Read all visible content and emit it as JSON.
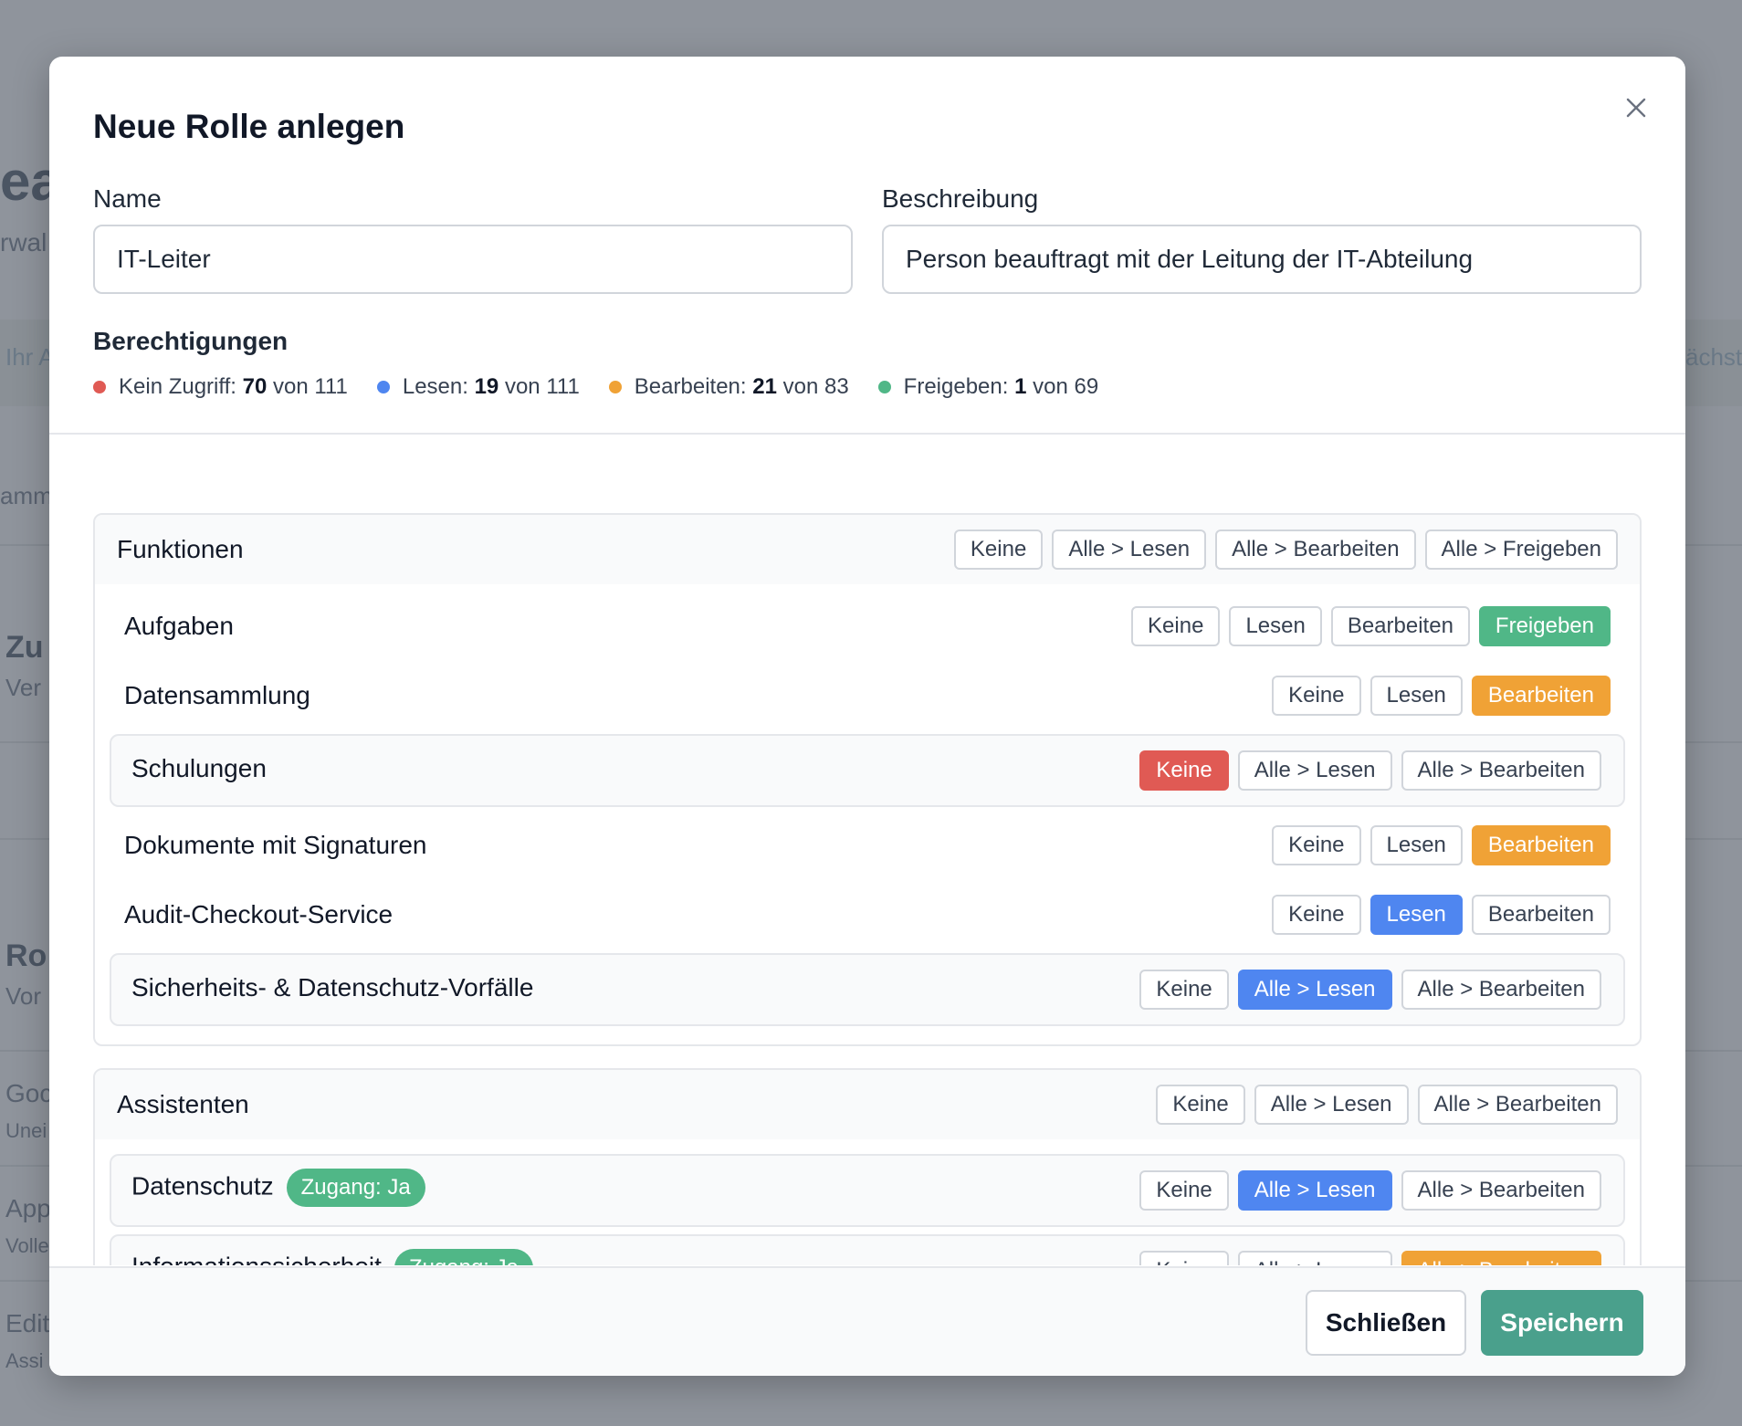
{
  "background": {
    "fragments": [
      "ea",
      "rwal",
      "Ihr A",
      "ächst",
      "amm",
      "Zu",
      "Ver",
      "Ro",
      "Vor",
      "Goc",
      "Unei",
      "App",
      "Volle",
      "Edit",
      "Assi"
    ]
  },
  "modal": {
    "title": "Neue Rolle anlegen",
    "close_icon": "close-icon",
    "name_label": "Name",
    "name_value": "IT-Leiter",
    "description_label": "Beschreibung",
    "description_value": "Person beauftragt mit der Leitung der IT-Abteilung",
    "permissions_title": "Berechtigungen",
    "legend": [
      {
        "label": "Kein Zugriff:",
        "count": "70",
        "of": "von 111",
        "color": "#e05a54"
      },
      {
        "label": "Lesen:",
        "count": "19",
        "of": "von 111",
        "color": "#4f86f0"
      },
      {
        "label": "Bearbeiten:",
        "count": "21",
        "of": "von 83",
        "color": "#f0a236"
      },
      {
        "label": "Freigeben:",
        "count": "1",
        "of": "von 69",
        "color": "#50b787"
      }
    ],
    "groups": [
      {
        "title": "Funktionen",
        "actions": [
          "Keine",
          "Alle > Lesen",
          "Alle > Bearbeiten",
          "Alle > Freigeben"
        ],
        "rows": [
          {
            "label": "Aufgaben",
            "options": [
              "Keine",
              "Lesen",
              "Bearbeiten",
              "Freigeben"
            ],
            "selected": "Freigeben"
          },
          {
            "label": "Datensammlung",
            "options": [
              "Keine",
              "Lesen",
              "Bearbeiten"
            ],
            "selected": "Bearbeiten"
          },
          {
            "label": "Schulungen",
            "options": [
              "Keine",
              "Alle > Lesen",
              "Alle > Bearbeiten"
            ],
            "selected": "Keine"
          },
          {
            "label": "Dokumente mit Signaturen",
            "options": [
              "Keine",
              "Lesen",
              "Bearbeiten"
            ],
            "selected": "Bearbeiten"
          },
          {
            "label": "Audit-Checkout-Service",
            "options": [
              "Keine",
              "Lesen",
              "Bearbeiten"
            ],
            "selected": "Lesen"
          },
          {
            "label": "Sicherheits- & Datenschutz-Vorfälle",
            "options": [
              "Keine",
              "Alle > Lesen",
              "Alle > Bearbeiten"
            ],
            "selected": "Alle > Lesen"
          }
        ]
      },
      {
        "title": "Assistenten",
        "actions": [
          "Keine",
          "Alle > Lesen",
          "Alle > Bearbeiten"
        ],
        "rows": [
          {
            "label": "Datenschutz",
            "badge": "Zugang: Ja",
            "options": [
              "Keine",
              "Alle > Lesen",
              "Alle > Bearbeiten"
            ],
            "selected": "Alle > Lesen"
          },
          {
            "label": "Informationssicherheit",
            "badge": "Zugang: Ja",
            "options": [
              "Keine",
              "Alle > Lesen",
              "Alle > Bearbeiten"
            ],
            "selected": "Alle > Bearbeiten"
          }
        ]
      }
    ],
    "footer": {
      "close_label": "Schließen",
      "save_label": "Speichern"
    },
    "colors": {
      "none": "#e05a54",
      "read": "#4f86f0",
      "edit": "#f0a236",
      "approve": "#50b787",
      "primary": "#4aa08c"
    }
  }
}
